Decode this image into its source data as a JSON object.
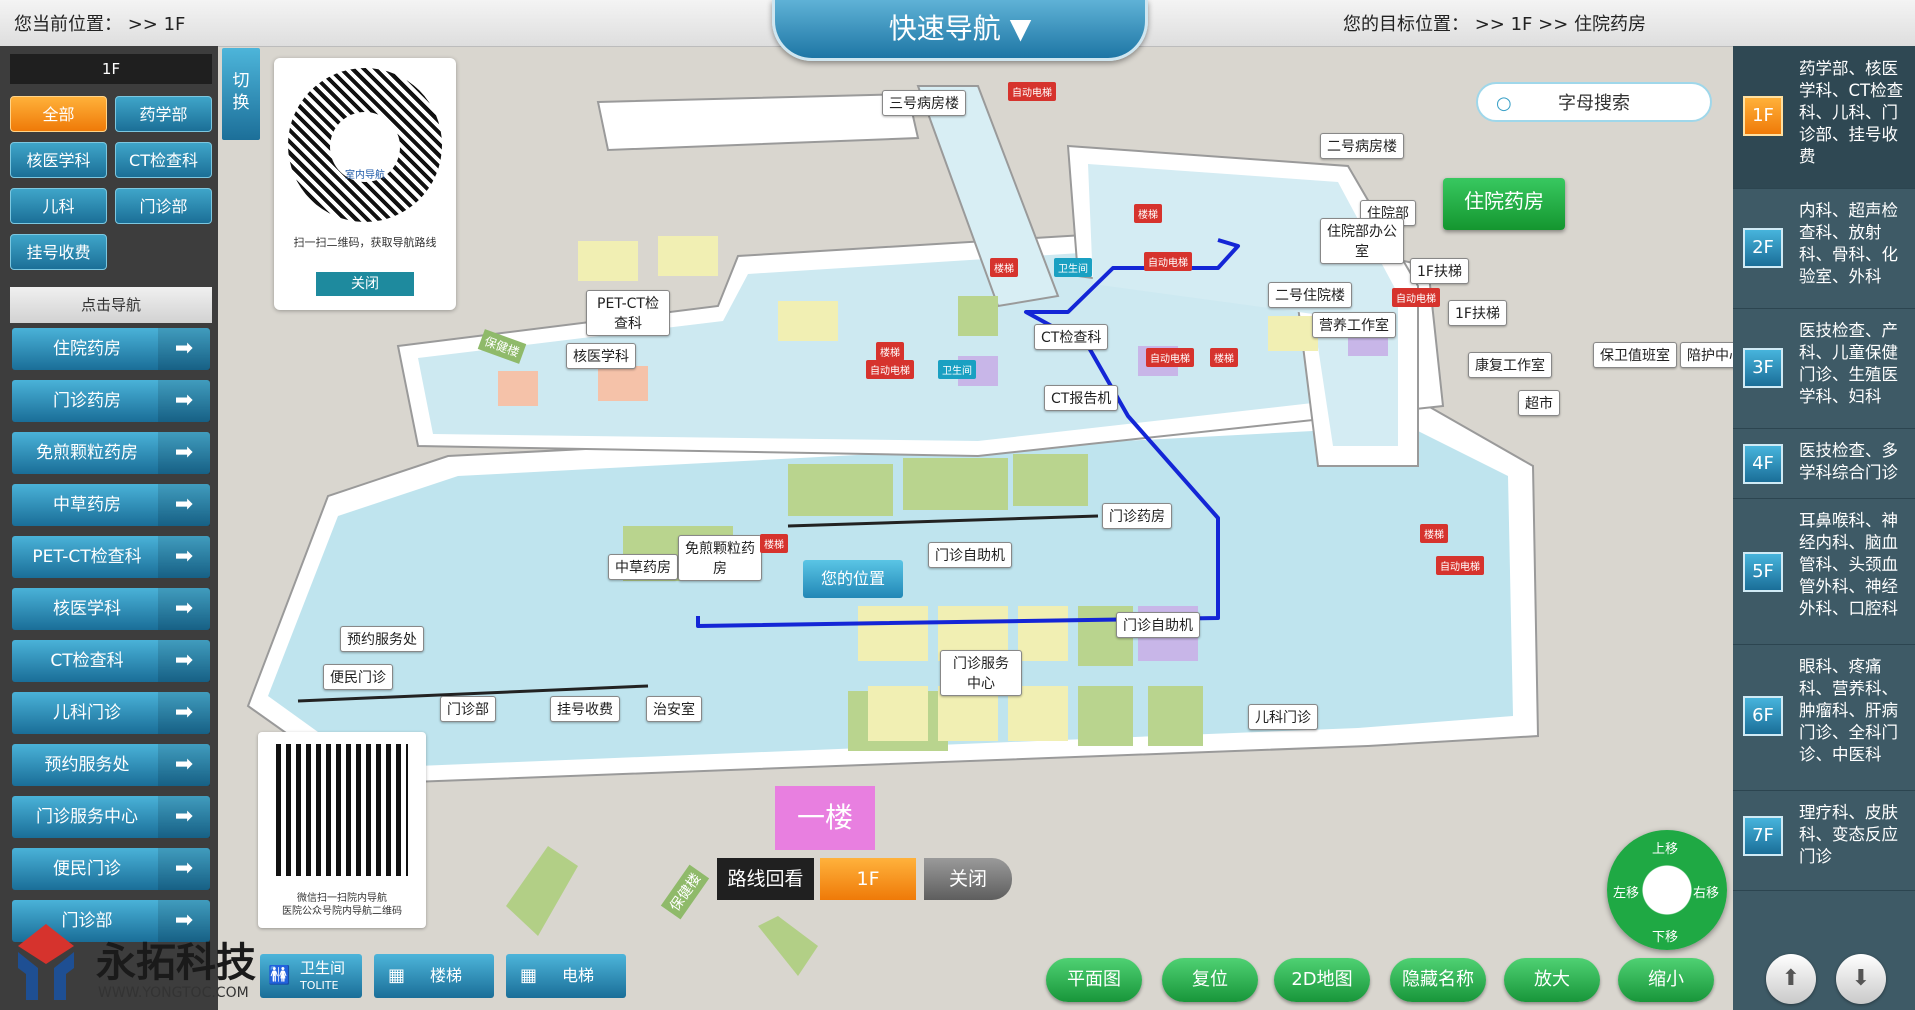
{
  "header": {
    "current_position": "您当前位置： >> 1F",
    "quick_nav": "快速导航",
    "target_position": "您的目标位置： >> 1F >> 住院药房"
  },
  "left_panel": {
    "floor_label": "1F",
    "categories": [
      "全部",
      "药学部",
      "核医学科",
      "CT检查科",
      "儿科",
      "门诊部",
      "挂号收费"
    ],
    "click_nav_header": "点击导航",
    "nav_items": [
      "住院药房",
      "门诊药房",
      "免煎颗粒药房",
      "中草药房",
      "PET-CT检查科",
      "核医学科",
      "CT检查科",
      "儿科门诊",
      "预约服务处",
      "门诊服务中心",
      "便民门诊",
      "门诊部"
    ]
  },
  "switch_button": "切换",
  "qr_popup": {
    "inner_label": "室内导航",
    "caption": "扫一扫二维码，获取导航路线",
    "close": "关闭"
  },
  "search": {
    "label": "字母搜索"
  },
  "map": {
    "destination": "住院药房",
    "you_are_here": "您的位置",
    "floor_marker": "一楼",
    "labels": [
      "三号病房楼",
      "二号病房楼",
      "住院部",
      "住院部办公室",
      "1F扶梯",
      "1F扶梯",
      "二号住院楼",
      "营养工作室",
      "保卫值班室",
      "陪护中心",
      "康复工作室",
      "超市",
      "PET-CT检查科",
      "核医学科",
      "CT检查科",
      "CT报告机",
      "门诊药房",
      "门诊自助机",
      "门诊自助机",
      "中草药房",
      "免煎颗粒药房",
      "预约服务处",
      "便民门诊",
      "门诊部",
      "挂号收费",
      "治安室",
      "门诊服务中心",
      "儿科门诊"
    ],
    "red_tags": [
      "自动电梯",
      "楼梯",
      "楼梯",
      "自动电梯",
      "楼梯",
      "自动电梯",
      "自动电梯",
      "楼梯",
      "自动电梯",
      "楼梯",
      "楼梯",
      "自动电梯"
    ],
    "cyan_tags": [
      "卫生间",
      "卫生间"
    ],
    "side_arrows": [
      "保健楼",
      "保健楼"
    ]
  },
  "route_bar": {
    "review": "路线回看",
    "floor": "1F",
    "close": "关闭"
  },
  "bottom_qr": {
    "caption_line1": "微信扫一扫院内导航",
    "caption_line2": "医院公众号院内导航二维码"
  },
  "facility_buttons": [
    {
      "label": "卫生间",
      "sub": "TOLITE"
    },
    {
      "label": "楼梯"
    },
    {
      "label": "电梯"
    }
  ],
  "map_buttons": [
    "平面图",
    "复位",
    "2D地图",
    "隐藏名称",
    "放大",
    "缩小"
  ],
  "pan_pad": {
    "up": "上移",
    "down": "下移",
    "left": "左移",
    "right": "右移"
  },
  "floors": [
    {
      "floor": "1F",
      "desc": "药学部、核医学科、CT检查科、儿科、门诊部、挂号收费",
      "active": true
    },
    {
      "floor": "2F",
      "desc": "内科、超声检查科、放射科、骨科、化验室、外科"
    },
    {
      "floor": "3F",
      "desc": "医技检查、产科、儿童保健门诊、生殖医学科、妇科"
    },
    {
      "floor": "4F",
      "desc": "医技检查、多学科综合门诊"
    },
    {
      "floor": "5F",
      "desc": "耳鼻喉科、神经内科、脑血管科、头颈血管外科、神经外科、口腔科"
    },
    {
      "floor": "6F",
      "desc": "眼科、疼痛科、营养科、肿瘤科、肝病门诊、全科门诊、中医科"
    },
    {
      "floor": "7F",
      "desc": "理疗科、皮肤科、变态反应门诊"
    }
  ],
  "logo": {
    "name": "永拓科技",
    "url": "WWW.YONGTOC.COM"
  },
  "colors": {
    "accent_blue": "#1e76a5",
    "active_orange": "#ef7a08",
    "route_line": "#1426d6",
    "destination_green": "#18963a"
  }
}
